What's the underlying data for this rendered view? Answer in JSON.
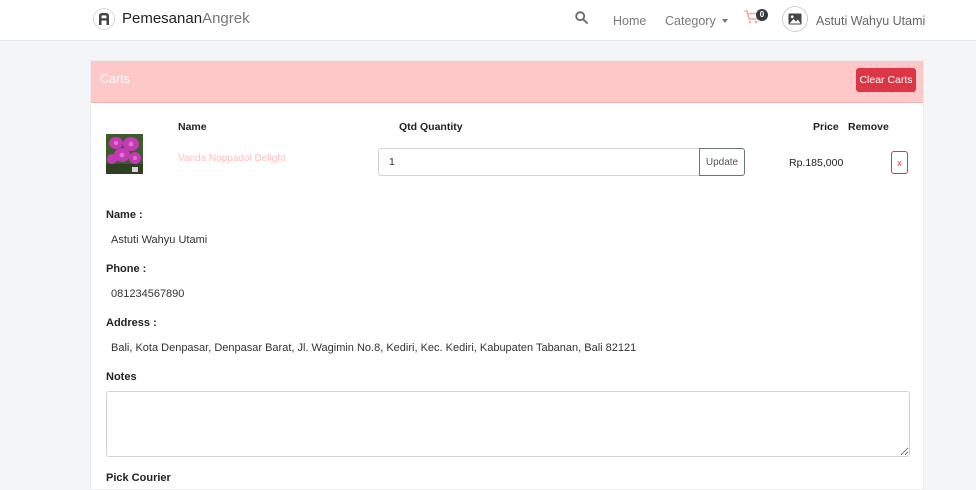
{
  "navbar": {
    "brand_strong": "Pemesanan",
    "brand_light": "Angrek",
    "links": {
      "home": "Home",
      "category": "Category"
    },
    "cart_count": "0",
    "user_name": "Astuti Wahyu Utami"
  },
  "cart": {
    "title": "Carts",
    "clear_label": "Clear Carts",
    "columns": {
      "name": "Name",
      "quantity": "Qtd Quantity",
      "price": "Price",
      "remove": "Remove"
    },
    "items": [
      {
        "name": "Vanda Noppadol Delight",
        "quantity": "1",
        "update_label": "Update",
        "price": "Rp.185,000",
        "remove_label": "x"
      }
    ]
  },
  "customer": {
    "name_label": "Name :",
    "name": "Astuti Wahyu Utami",
    "phone_label": "Phone :",
    "phone": "081234567890",
    "address_label": "Address :",
    "address": "Bali, Kota Denpasar, Denpasar Barat, Jl. Wagimin No.8, Kediri, Kec. Kediri, Kabupaten Tabanan, Bali 82121",
    "notes_label": "Notes",
    "notes_value": "",
    "courier_label": "Pick Courier"
  },
  "colors": {
    "header_bg": "#ffc8c8",
    "danger": "#dc3545",
    "badge": "#343a40"
  }
}
